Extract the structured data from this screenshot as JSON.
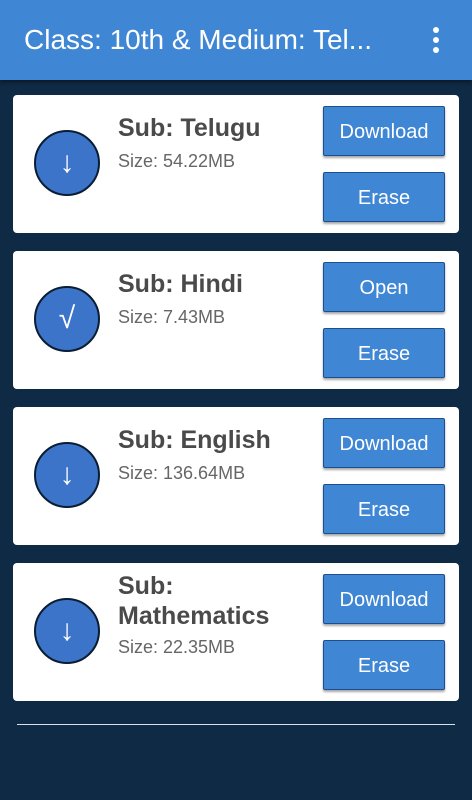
{
  "appbar": {
    "title": "Class: 10th & Medium: Tel...",
    "menu_icon": "more-vert-icon"
  },
  "subjects": [
    {
      "name": "Sub: Telugu",
      "size": "Size: 54.22MB",
      "status_icon": "download-arrow-icon",
      "status_glyph": "↓",
      "primary_label": "Download",
      "secondary_label": "Erase"
    },
    {
      "name": "Sub: Hindi",
      "size": "Size: 7.43MB",
      "status_icon": "check-icon",
      "status_glyph": "√",
      "primary_label": "Open",
      "secondary_label": "Erase"
    },
    {
      "name": "Sub: English",
      "size": "Size: 136.64MB",
      "status_icon": "download-arrow-icon",
      "status_glyph": "↓",
      "primary_label": "Download",
      "secondary_label": "Erase"
    },
    {
      "name": "Sub: Mathematics",
      "size": "Size: 22.35MB",
      "status_icon": "download-arrow-icon",
      "status_glyph": "↓",
      "primary_label": "Download",
      "secondary_label": "Erase"
    }
  ],
  "colors": {
    "appbar": "#3f86d4",
    "background": "#0f2a45",
    "button": "#3f86d4",
    "status_circle": "#3b74c8"
  }
}
